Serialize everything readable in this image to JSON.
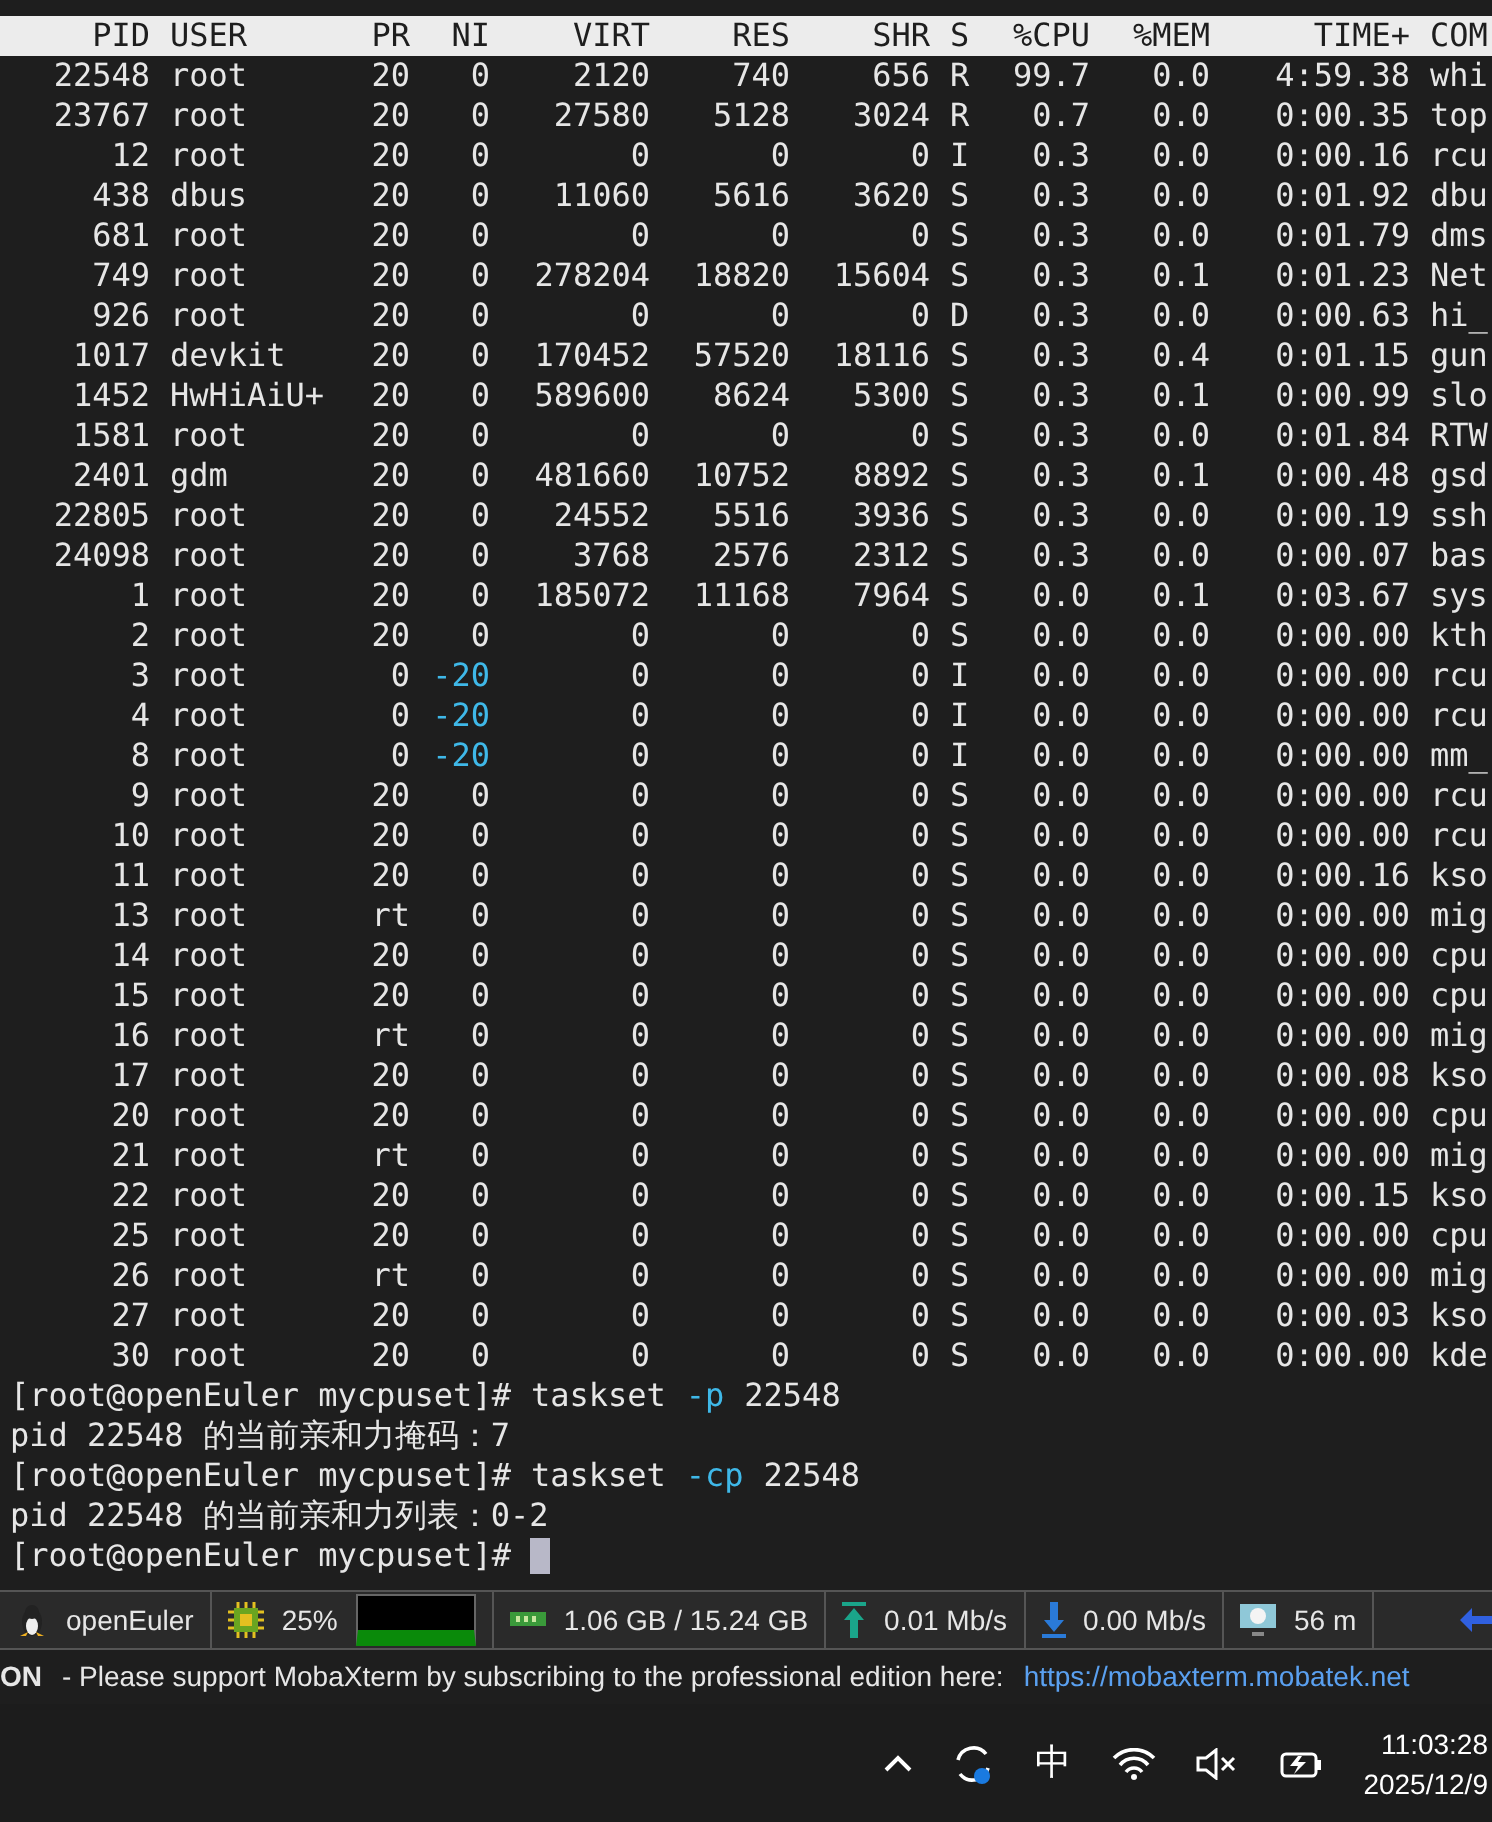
{
  "top": {
    "columns": [
      "PID",
      "USER",
      "PR",
      "NI",
      "VIRT",
      "RES",
      "SHR",
      "S",
      "%CPU",
      "%MEM",
      "TIME+",
      "COM"
    ],
    "rows": [
      {
        "cells": [
          "22548",
          "root",
          "20",
          "0",
          "2120",
          "740",
          "656",
          "R",
          "99.7",
          "0.0",
          "4:59.38",
          "whi"
        ]
      },
      {
        "cells": [
          "23767",
          "root",
          "20",
          "0",
          "27580",
          "5128",
          "3024",
          "R",
          "0.7",
          "0.0",
          "0:00.35",
          "top"
        ]
      },
      {
        "cells": [
          "12",
          "root",
          "20",
          "0",
          "0",
          "0",
          "0",
          "I",
          "0.3",
          "0.0",
          "0:00.16",
          "rcu"
        ]
      },
      {
        "cells": [
          "438",
          "dbus",
          "20",
          "0",
          "11060",
          "5616",
          "3620",
          "S",
          "0.3",
          "0.0",
          "0:01.92",
          "dbu"
        ]
      },
      {
        "cells": [
          "681",
          "root",
          "20",
          "0",
          "0",
          "0",
          "0",
          "S",
          "0.3",
          "0.0",
          "0:01.79",
          "dms"
        ]
      },
      {
        "cells": [
          "749",
          "root",
          "20",
          "0",
          "278204",
          "18820",
          "15604",
          "S",
          "0.3",
          "0.1",
          "0:01.23",
          "Net"
        ]
      },
      {
        "cells": [
          "926",
          "root",
          "20",
          "0",
          "0",
          "0",
          "0",
          "D",
          "0.3",
          "0.0",
          "0:00.63",
          "hi_"
        ]
      },
      {
        "cells": [
          "1017",
          "devkit",
          "20",
          "0",
          "170452",
          "57520",
          "18116",
          "S",
          "0.3",
          "0.4",
          "0:01.15",
          "gun"
        ]
      },
      {
        "cells": [
          "1452",
          "HwHiAiU+",
          "20",
          "0",
          "589600",
          "8624",
          "5300",
          "S",
          "0.3",
          "0.1",
          "0:00.99",
          "slo"
        ]
      },
      {
        "cells": [
          "1581",
          "root",
          "20",
          "0",
          "0",
          "0",
          "0",
          "S",
          "0.3",
          "0.0",
          "0:01.84",
          "RTW"
        ]
      },
      {
        "cells": [
          "2401",
          "gdm",
          "20",
          "0",
          "481660",
          "10752",
          "8892",
          "S",
          "0.3",
          "0.1",
          "0:00.48",
          "gsd"
        ]
      },
      {
        "cells": [
          "22805",
          "root",
          "20",
          "0",
          "24552",
          "5516",
          "3936",
          "S",
          "0.3",
          "0.0",
          "0:00.19",
          "ssh"
        ]
      },
      {
        "cells": [
          "24098",
          "root",
          "20",
          "0",
          "3768",
          "2576",
          "2312",
          "S",
          "0.3",
          "0.0",
          "0:00.07",
          "bas"
        ]
      },
      {
        "cells": [
          "1",
          "root",
          "20",
          "0",
          "185072",
          "11168",
          "7964",
          "S",
          "0.0",
          "0.1",
          "0:03.67",
          "sys"
        ]
      },
      {
        "cells": [
          "2",
          "root",
          "20",
          "0",
          "0",
          "0",
          "0",
          "S",
          "0.0",
          "0.0",
          "0:00.00",
          "kth"
        ]
      },
      {
        "cells": [
          "3",
          "root",
          "0",
          "-20",
          "0",
          "0",
          "0",
          "I",
          "0.0",
          "0.0",
          "0:00.00",
          "rcu"
        ],
        "color": "#3fb8e8"
      },
      {
        "cells": [
          "4",
          "root",
          "0",
          "-20",
          "0",
          "0",
          "0",
          "I",
          "0.0",
          "0.0",
          "0:00.00",
          "rcu"
        ],
        "color": "#3fb8e8"
      },
      {
        "cells": [
          "8",
          "root",
          "0",
          "-20",
          "0",
          "0",
          "0",
          "I",
          "0.0",
          "0.0",
          "0:00.00",
          "mm_"
        ],
        "color": "#3fb8e8"
      },
      {
        "cells": [
          "9",
          "root",
          "20",
          "0",
          "0",
          "0",
          "0",
          "S",
          "0.0",
          "0.0",
          "0:00.00",
          "rcu"
        ]
      },
      {
        "cells": [
          "10",
          "root",
          "20",
          "0",
          "0",
          "0",
          "0",
          "S",
          "0.0",
          "0.0",
          "0:00.00",
          "rcu"
        ]
      },
      {
        "cells": [
          "11",
          "root",
          "20",
          "0",
          "0",
          "0",
          "0",
          "S",
          "0.0",
          "0.0",
          "0:00.16",
          "kso"
        ]
      },
      {
        "cells": [
          "13",
          "root",
          "rt",
          "0",
          "0",
          "0",
          "0",
          "S",
          "0.0",
          "0.0",
          "0:00.00",
          "mig"
        ]
      },
      {
        "cells": [
          "14",
          "root",
          "20",
          "0",
          "0",
          "0",
          "0",
          "S",
          "0.0",
          "0.0",
          "0:00.00",
          "cpu"
        ]
      },
      {
        "cells": [
          "15",
          "root",
          "20",
          "0",
          "0",
          "0",
          "0",
          "S",
          "0.0",
          "0.0",
          "0:00.00",
          "cpu"
        ]
      },
      {
        "cells": [
          "16",
          "root",
          "rt",
          "0",
          "0",
          "0",
          "0",
          "S",
          "0.0",
          "0.0",
          "0:00.00",
          "mig"
        ]
      },
      {
        "cells": [
          "17",
          "root",
          "20",
          "0",
          "0",
          "0",
          "0",
          "S",
          "0.0",
          "0.0",
          "0:00.08",
          "kso"
        ]
      },
      {
        "cells": [
          "20",
          "root",
          "20",
          "0",
          "0",
          "0",
          "0",
          "S",
          "0.0",
          "0.0",
          "0:00.00",
          "cpu"
        ]
      },
      {
        "cells": [
          "21",
          "root",
          "rt",
          "0",
          "0",
          "0",
          "0",
          "S",
          "0.0",
          "0.0",
          "0:00.00",
          "mig"
        ]
      },
      {
        "cells": [
          "22",
          "root",
          "20",
          "0",
          "0",
          "0",
          "0",
          "S",
          "0.0",
          "0.0",
          "0:00.15",
          "kso"
        ]
      },
      {
        "cells": [
          "25",
          "root",
          "20",
          "0",
          "0",
          "0",
          "0",
          "S",
          "0.0",
          "0.0",
          "0:00.00",
          "cpu"
        ]
      },
      {
        "cells": [
          "26",
          "root",
          "rt",
          "0",
          "0",
          "0",
          "0",
          "S",
          "0.0",
          "0.0",
          "0:00.00",
          "mig"
        ]
      },
      {
        "cells": [
          "27",
          "root",
          "20",
          "0",
          "0",
          "0",
          "0",
          "S",
          "0.0",
          "0.0",
          "0:00.03",
          "kso"
        ]
      },
      {
        "cells": [
          "30",
          "root",
          "20",
          "0",
          "0",
          "0",
          "0",
          "S",
          "0.0",
          "0.0",
          "0:00.00",
          "kde"
        ]
      }
    ]
  },
  "terminal_lines": [
    {
      "kind": "command",
      "prompt": "[root@openEuler mycpuset]#",
      "command": "taskset",
      "flag": "-p",
      "arg": "22548"
    },
    {
      "kind": "output",
      "text": "pid 22548 的当前亲和力掩码：7"
    },
    {
      "kind": "command",
      "prompt": "[root@openEuler mycpuset]#",
      "command": "taskset",
      "flag": "-cp",
      "arg": "22548"
    },
    {
      "kind": "output",
      "text": "pid 22548 的当前亲和力列表：0-2"
    },
    {
      "kind": "cursor",
      "prompt": "[root@openEuler mycpuset]#"
    }
  ],
  "status_bar": [
    {
      "kind": "os",
      "text": "openEuler"
    },
    {
      "kind": "cpu",
      "text": "25%"
    },
    {
      "kind": "memory",
      "text": "1.06 GB / 15.24 GB"
    },
    {
      "kind": "upload",
      "text": "0.01 Mb/s"
    },
    {
      "kind": "download",
      "text": "0.00 Mb/s"
    },
    {
      "kind": "uptime",
      "text": "56 m"
    }
  ],
  "notice": {
    "label": "ON",
    "text": "-  Please support MobaXterm by subscribing to the professional edition here:",
    "link": "https://mobaxterm.mobatek.net"
  },
  "taskbar": {
    "ime": "中",
    "time": "11:03:28",
    "date": "2025/12/9"
  }
}
